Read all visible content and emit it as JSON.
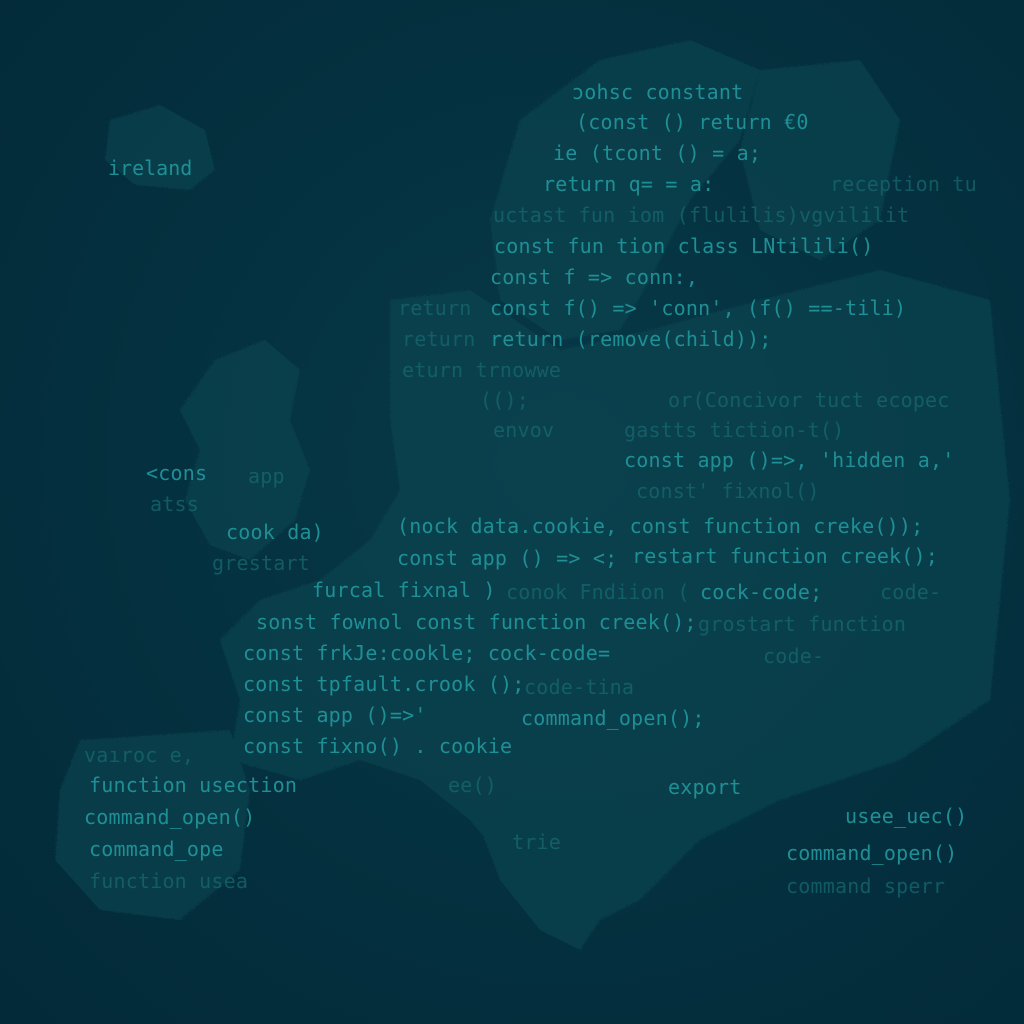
{
  "map_label": "ireland",
  "code_lines": [
    {
      "text": "ɔohsc constant",
      "cls": "bright"
    },
    {
      "text": "(const ()  return €0",
      "cls": ""
    },
    {
      "text": "ie (tcont () = a;",
      "cls": ""
    },
    {
      "text": "return q= = a:",
      "cls": ""
    },
    {
      "text": "reception tu",
      "cls": "dim"
    },
    {
      "text": "uctast fun   iom (flulilis)vgvililit",
      "cls": "dim"
    },
    {
      "text": "const fun tion class LNtilili() ",
      "cls": ""
    },
    {
      "text": "const f   => conn:,",
      "cls": ""
    },
    {
      "text": "return",
      "cls": "dim"
    },
    {
      "text": "const  f() => 'conn', (f() ==-tili)",
      "cls": ""
    },
    {
      "text": "return",
      "cls": "dim"
    },
    {
      "text": "return  (remove(child));",
      "cls": ""
    },
    {
      "text": "eturn  trnowwe",
      "cls": "dim"
    },
    {
      "text": "(();",
      "cls": "dim"
    },
    {
      "text": "or(Concivor tuct ecopec",
      "cls": "dim"
    },
    {
      "text": "envov",
      "cls": "dim"
    },
    {
      "text": "gastts tiction-t()",
      "cls": "dim"
    },
    {
      "text": "const app ()=>, 'hidden a,'",
      "cls": ""
    },
    {
      "text": "<cons",
      "cls": ""
    },
    {
      "text": "app",
      "cls": "dim"
    },
    {
      "text": "const' fixnol()",
      "cls": "dim"
    },
    {
      "text": "atss",
      "cls": "dim"
    },
    {
      "text": "cook da)",
      "cls": ""
    },
    {
      "text": "(nock data.cookie,  const function creke());",
      "cls": ""
    },
    {
      "text": "grestart",
      "cls": "dim"
    },
    {
      "text": "const app () => <;",
      "cls": ""
    },
    {
      "text": "restart function creek();",
      "cls": ""
    },
    {
      "text": "furcal  fixnal )",
      "cls": ""
    },
    {
      "text": "conok Fndiion (",
      "cls": "dim"
    },
    {
      "text": "cock-code;",
      "cls": ""
    },
    {
      "text": "code-",
      "cls": "dim"
    },
    {
      "text": "sonst fownol  const function creek();",
      "cls": ""
    },
    {
      "text": "grostart function",
      "cls": "dim"
    },
    {
      "text": "const frkJe:cookle;  cock-code=",
      "cls": ""
    },
    {
      "text": "code-",
      "cls": "dim"
    },
    {
      "text": "const tpfault.crook ();",
      "cls": ""
    },
    {
      "text": "code-tina",
      "cls": "dim"
    },
    {
      "text": "const app ()=>'",
      "cls": ""
    },
    {
      "text": "command_open();",
      "cls": ""
    },
    {
      "text": "const fixno() . cookie",
      "cls": ""
    },
    {
      "text": "vaıroc e,",
      "cls": "dim"
    },
    {
      "text": "function usection",
      "cls": ""
    },
    {
      "text": "ee()",
      "cls": "dim"
    },
    {
      "text": "export",
      "cls": ""
    },
    {
      "text": "command_open()",
      "cls": ""
    },
    {
      "text": "usee_uec()",
      "cls": ""
    },
    {
      "text": "command_ope",
      "cls": ""
    },
    {
      "text": "command_open()",
      "cls": ""
    },
    {
      "text": "function usea",
      "cls": "dim"
    },
    {
      "text": "command sperr",
      "cls": "dim"
    },
    {
      "text": "trie",
      "cls": "dim"
    }
  ],
  "colors": {
    "background": "#04303f",
    "land": "#0b4a52",
    "code": "#1f8f96"
  }
}
